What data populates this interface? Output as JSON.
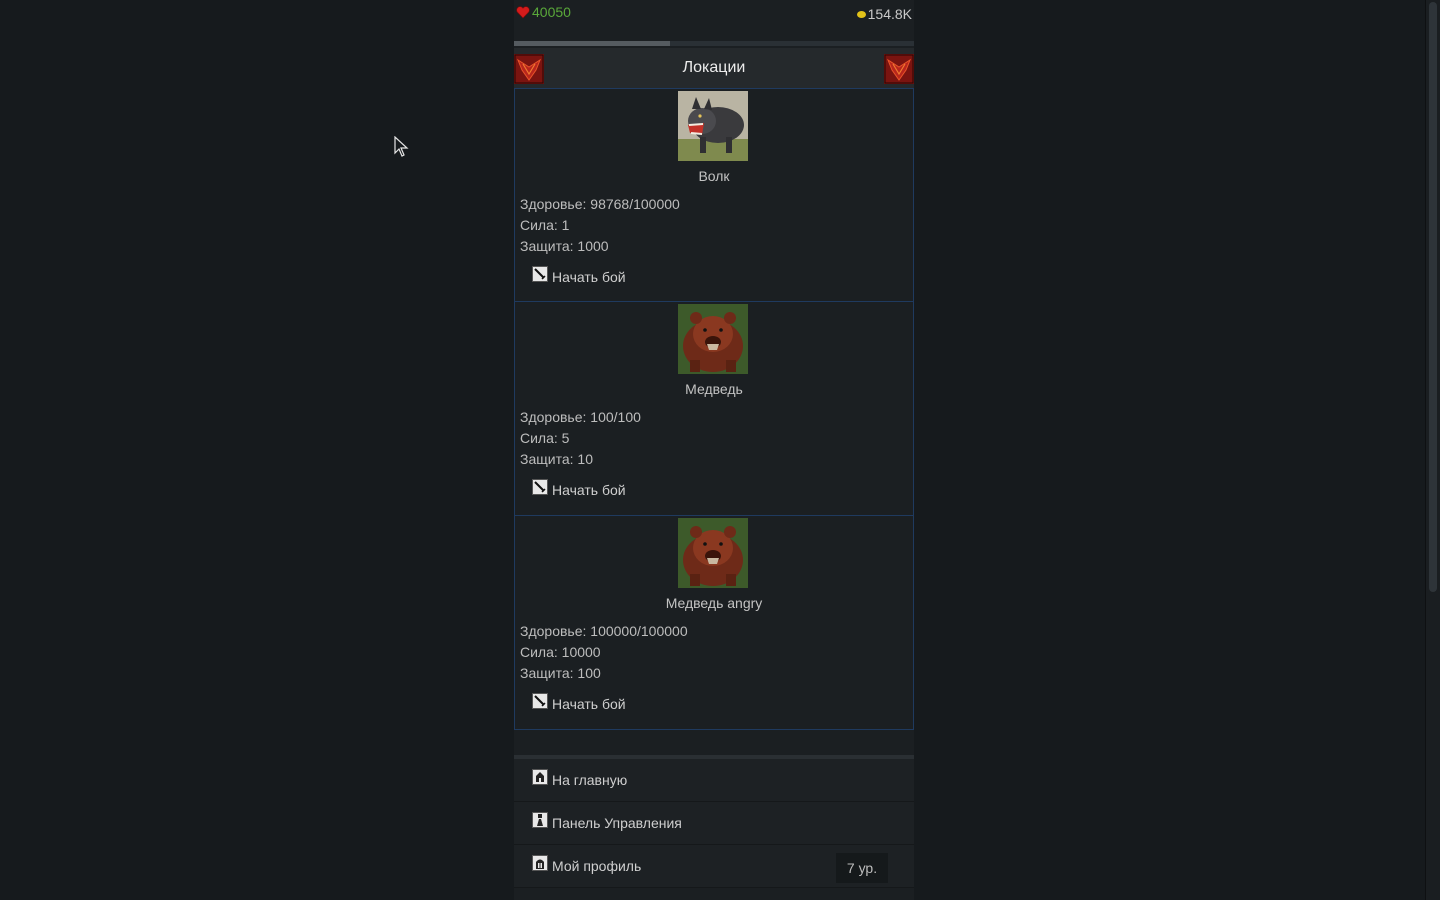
{
  "top_bar": {
    "hp": "40050",
    "gold": "154.8K"
  },
  "xp": {
    "fraction": 0.39
  },
  "header": {
    "title": "Локации"
  },
  "monsters": [
    {
      "name": "Волк",
      "health": "Здоровье: 98768/100000",
      "strength": "Сила: 1",
      "defense": "Защита: 1000",
      "action": "Начать бой",
      "portrait": "wolf"
    },
    {
      "name": "Медведь",
      "health": "Здоровье: 100/100",
      "strength": "Сила: 5",
      "defense": "Защита: 10",
      "action": "Начать бой",
      "portrait": "bear"
    },
    {
      "name": "Медведь angry",
      "health": "Здоровье: 100000/100000",
      "strength": "Сила: 10000",
      "defense": "Защита: 100",
      "action": "Начать бой",
      "portrait": "bear"
    }
  ],
  "menu": [
    {
      "label": "На главную",
      "icon": "home-icon"
    },
    {
      "label": "Панель Управления",
      "icon": "control-panel-icon"
    },
    {
      "label": "Мой профиль",
      "icon": "profile-icon",
      "badge": "7 ур."
    }
  ],
  "colors": {
    "accent_border": "#1f3a5f",
    "hp_text": "#5aa83a",
    "gold": "#e2c219"
  }
}
